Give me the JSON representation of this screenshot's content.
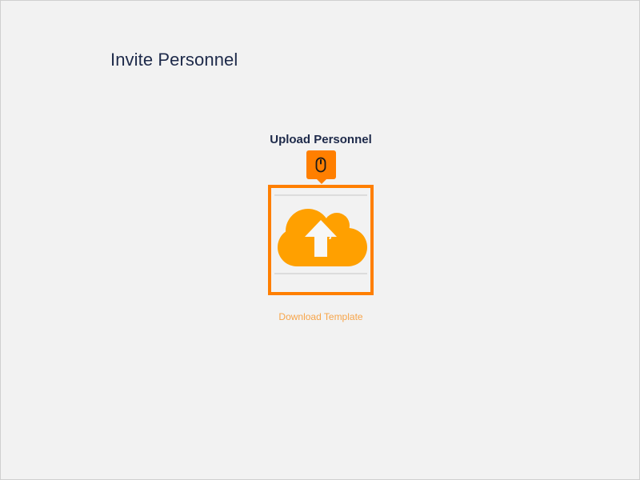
{
  "page": {
    "title": "Invite Personnel"
  },
  "upload": {
    "heading": "Upload Personnel",
    "dropzone_icon": "cloud-upload-icon",
    "marker_icon": "mouse-icon",
    "download_link": "Download Template"
  },
  "colors": {
    "accent": "#ff7f00",
    "cloud": "#ffa000",
    "link": "#f7a54a",
    "heading": "#1e2a4a",
    "background": "#f2f2f2"
  }
}
